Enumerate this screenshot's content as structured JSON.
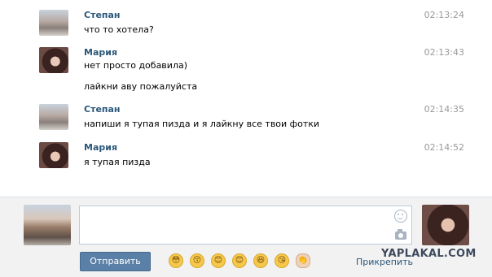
{
  "messages": [
    {
      "author": "Степан",
      "time": "02:13:24",
      "lines": [
        "что то хотела?"
      ],
      "avatar_icon": "stepan-avatar"
    },
    {
      "author": "Мария",
      "time": "02:13:43",
      "lines": [
        "нет просто добавила)",
        "лайкни аву пожалуйста"
      ],
      "avatar_icon": "maria-avatar"
    },
    {
      "author": "Степан",
      "time": "02:14:35",
      "lines": [
        "напиши я тупая пизда и я лайкну все твои фотки"
      ],
      "avatar_icon": "stepan-avatar"
    },
    {
      "author": "Мария",
      "time": "02:14:52",
      "lines": [
        "я тупая пизда"
      ],
      "avatar_icon": "maria-avatar"
    }
  ],
  "composer": {
    "input_value": "",
    "send_label": "Отправить",
    "attach_label": "Прикрепить",
    "emojis": [
      "😳",
      "😚",
      "😊",
      "😊",
      "😆",
      "😘",
      "👏"
    ]
  },
  "watermark": "YAPLAKAL.COM",
  "colors": {
    "author": "#2b587a",
    "time": "#999999",
    "send_button": "#5b80a7",
    "composer_bg": "#f2f2f2"
  }
}
